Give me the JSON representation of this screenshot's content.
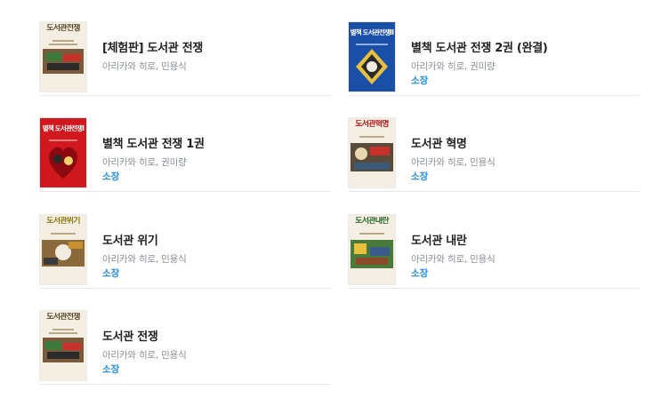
{
  "books": [
    {
      "title": "[체험판] 도서관 전쟁",
      "authors": "아리카와 히로, 민용식",
      "badge": "",
      "cover_text": "도서관전쟁",
      "cover_variant": "war"
    },
    {
      "title": "별책 도서관 전쟁 2권 (완결)",
      "authors": "아리카와 히로, 권미량",
      "badge": "소장",
      "cover_text": "별책 도서관전쟁Ⅱ",
      "cover_variant": "blue"
    },
    {
      "title": "별책 도서관 전쟁 1권",
      "authors": "아리카와 히로, 권미량",
      "badge": "소장",
      "cover_text": "별책 도서관전쟁Ⅰ",
      "cover_variant": "red"
    },
    {
      "title": "도서관 혁명",
      "authors": "아리카와 히로, 민용식",
      "badge": "소장",
      "cover_text": "도서관혁명",
      "cover_variant": "revolution"
    },
    {
      "title": "도서관 위기",
      "authors": "아리카와 히로, 민용식",
      "badge": "소장",
      "cover_text": "도서관위기",
      "cover_variant": "crisis"
    },
    {
      "title": "도서관 내란",
      "authors": "아리카와 히로, 민용식",
      "badge": "소장",
      "cover_text": "도서관내란",
      "cover_variant": "rebellion"
    },
    {
      "title": "도서관 전쟁",
      "authors": "아리카와 히로, 민용식",
      "badge": "소장",
      "cover_text": "도서관전쟁",
      "cover_variant": "war"
    }
  ],
  "colors": {
    "title": "#1f2021",
    "authors": "#8a8f98",
    "badge": "#1f8ce6",
    "divider": "#e6e8eb",
    "cover_war_title": "#5a4a2a",
    "cover_blue_bg": "#1a4fa8",
    "cover_red_bg": "#d0181e",
    "cover_revolution_title": "#c0141a",
    "cover_crisis_title": "#8a7a10",
    "cover_rebellion_title": "#2e6a2e"
  },
  "icons": [
    "book-cover-image"
  ]
}
